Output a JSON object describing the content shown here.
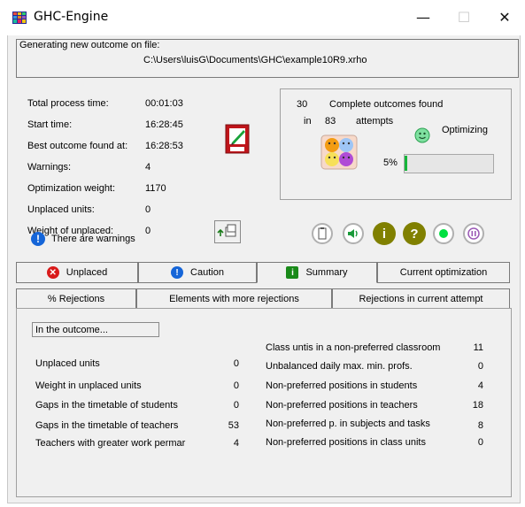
{
  "window": {
    "title": "GHC-Engine",
    "minimize": "—",
    "maximize": "☐",
    "close": "✕"
  },
  "file": {
    "label": "Generating new outcome on file:",
    "path": "C:\\Users\\luisG\\Documents\\GHC\\example10R9.xrho"
  },
  "info": {
    "total_process_time_label": "Total process time:",
    "total_process_time": "00:01:03",
    "start_time_label": "Start time:",
    "start_time": "16:28:45",
    "best_outcome_label": "Best outcome found at:",
    "best_outcome": "16:28:53",
    "warnings_label": "Warnings:",
    "warnings": "4",
    "optimization_weight_label": "Optimization weight:",
    "optimization_weight": "1170",
    "unplaced_units_label": "Unplaced units:",
    "unplaced_units": "0",
    "weight_unplaced_label": "Weight of unplaced:",
    "weight_unplaced": "0",
    "warning_message": "There are warnings"
  },
  "status": {
    "complete_count": "30",
    "complete_label": "Complete outcomes found",
    "in_label": "in",
    "attempts_count": "83",
    "attempts_label": "attempts",
    "optimizing_label": "Optimizing",
    "progress_label": "5%",
    "progress_value": 0.03
  },
  "tabs_row1": [
    {
      "label": "Unplaced",
      "icon": "x-icon"
    },
    {
      "label": "Caution",
      "icon": "exclamation-icon"
    },
    {
      "label": "Summary",
      "icon": "info-icon"
    },
    {
      "label": "Current optimization",
      "icon": ""
    }
  ],
  "tabs_row2": [
    {
      "label": "% Rejections"
    },
    {
      "label": "Elements with more rejections"
    },
    {
      "label": "Rejections in current attempt"
    }
  ],
  "summary": {
    "heading": "In the outcome...",
    "left": [
      {
        "label": "Unplaced units",
        "value": "0"
      },
      {
        "label": "Weight in unplaced units",
        "value": "0"
      },
      {
        "label": "Gaps in the timetable of students",
        "value": "0"
      },
      {
        "label": "Gaps in the timetable of teachers",
        "value": "53"
      },
      {
        "label": "Teachers with greater work permar",
        "value": "4"
      }
    ],
    "right": [
      {
        "label": "Class untis in a non-preferred classroom",
        "value": "11"
      },
      {
        "label": "Unbalanced daily max. min. profs.",
        "value": "0"
      },
      {
        "label": "Non-preferred positions in students",
        "value": "4"
      },
      {
        "label": "Non-preferred positions in teachers",
        "value": "18"
      },
      {
        "label": "Non-preferred p. in subjects and tasks",
        "value": "8"
      },
      {
        "label": "Non-preferred positions in class units",
        "value": "0"
      }
    ]
  },
  "colors": {
    "progress_fill": "#16b53a",
    "info_icon": "#808000",
    "help_icon": "#808000",
    "record_dot": "#00e040",
    "pause_ring": "#9b59b6",
    "warning_icon": "#1565d8",
    "unplaced_icon": "#d91b1b"
  }
}
